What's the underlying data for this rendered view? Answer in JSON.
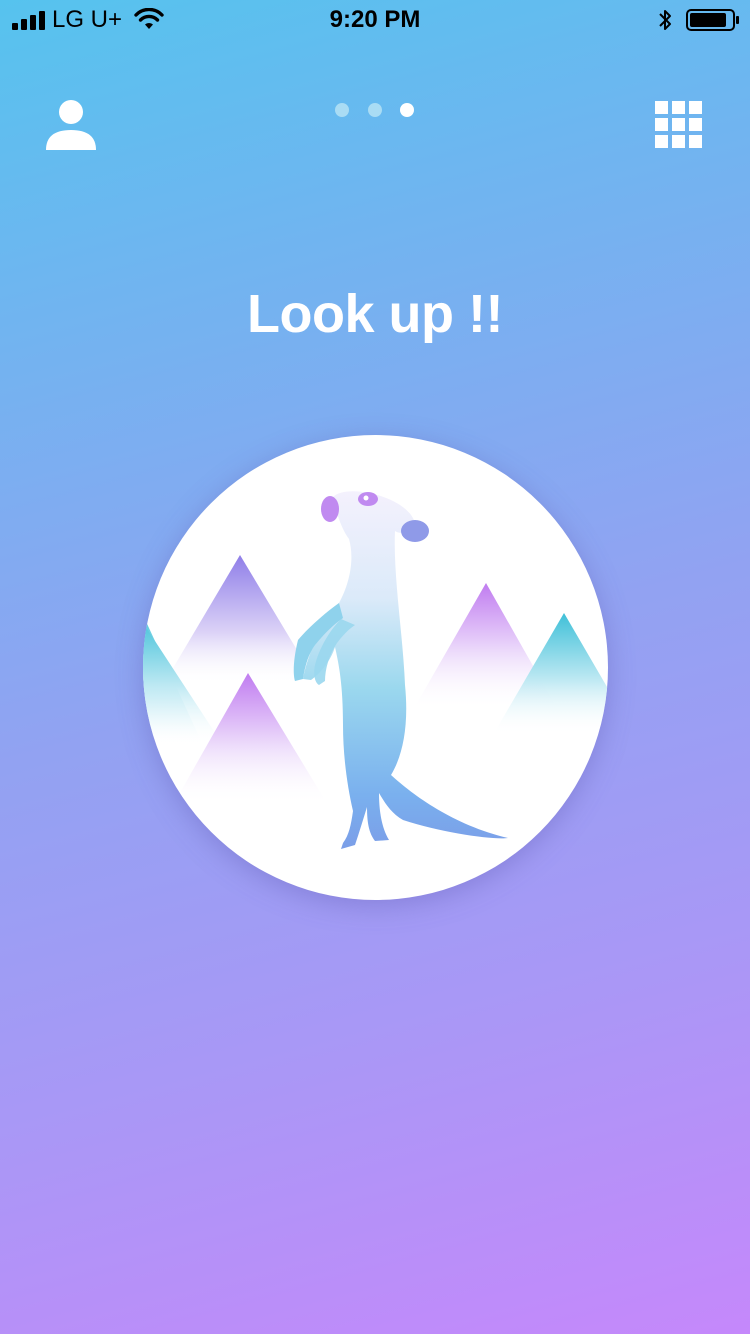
{
  "status_bar": {
    "carrier": "LG U+",
    "time": "9:20 PM",
    "icons": [
      "signal-icon",
      "wifi-icon",
      "bluetooth-icon",
      "battery-icon"
    ]
  },
  "nav": {
    "left_icon": "user-profile-icon",
    "right_icon": "grid-menu-icon",
    "page_indicator": {
      "count": 3,
      "active_index": 2
    }
  },
  "main": {
    "title": "Look up !!",
    "illustration": "meerkat-mountains-illustration"
  },
  "colors": {
    "gradient_top": "#56c3ee",
    "gradient_bottom": "#c588fb",
    "text": "#ffffff",
    "dot_inactive": "#a9dcf4",
    "dot_active": "#ffffff"
  }
}
